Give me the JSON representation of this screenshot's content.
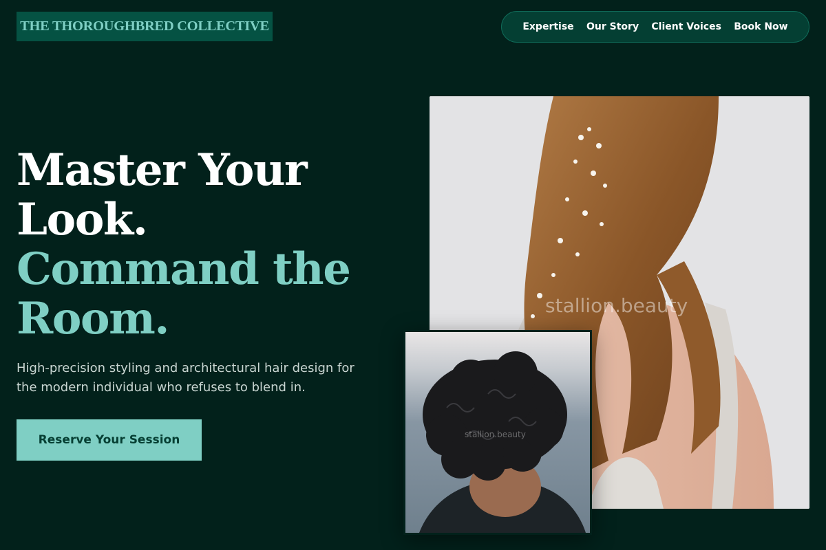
{
  "header": {
    "logo_text": "THE THOROUGHBRED COLLECTIVE",
    "nav": [
      {
        "label": "Expertise"
      },
      {
        "label": "Our Story"
      },
      {
        "label": "Client Voices"
      },
      {
        "label": "Book Now"
      }
    ]
  },
  "hero": {
    "headline_white": [
      "Master Your",
      "Look."
    ],
    "headline_teal": [
      "Command the",
      "Room."
    ],
    "subtext": "High-precision styling and architectural hair design for the modern individual who refuses to blend in.",
    "cta_label": "Reserve Your Session"
  },
  "images": {
    "main": {
      "subject": "woman-long-wavy-hair-with-pearl-hairpiece",
      "watermark": "stallion.beauty"
    },
    "inset": {
      "subject": "man-curly-dark-hair",
      "watermark": "stallion.beauty"
    }
  },
  "colors": {
    "background": "#02211b",
    "accent": "#7fcfc4",
    "logo_bg": "#055243",
    "nav_bg": "#043f33",
    "cta_text": "#063f33"
  }
}
